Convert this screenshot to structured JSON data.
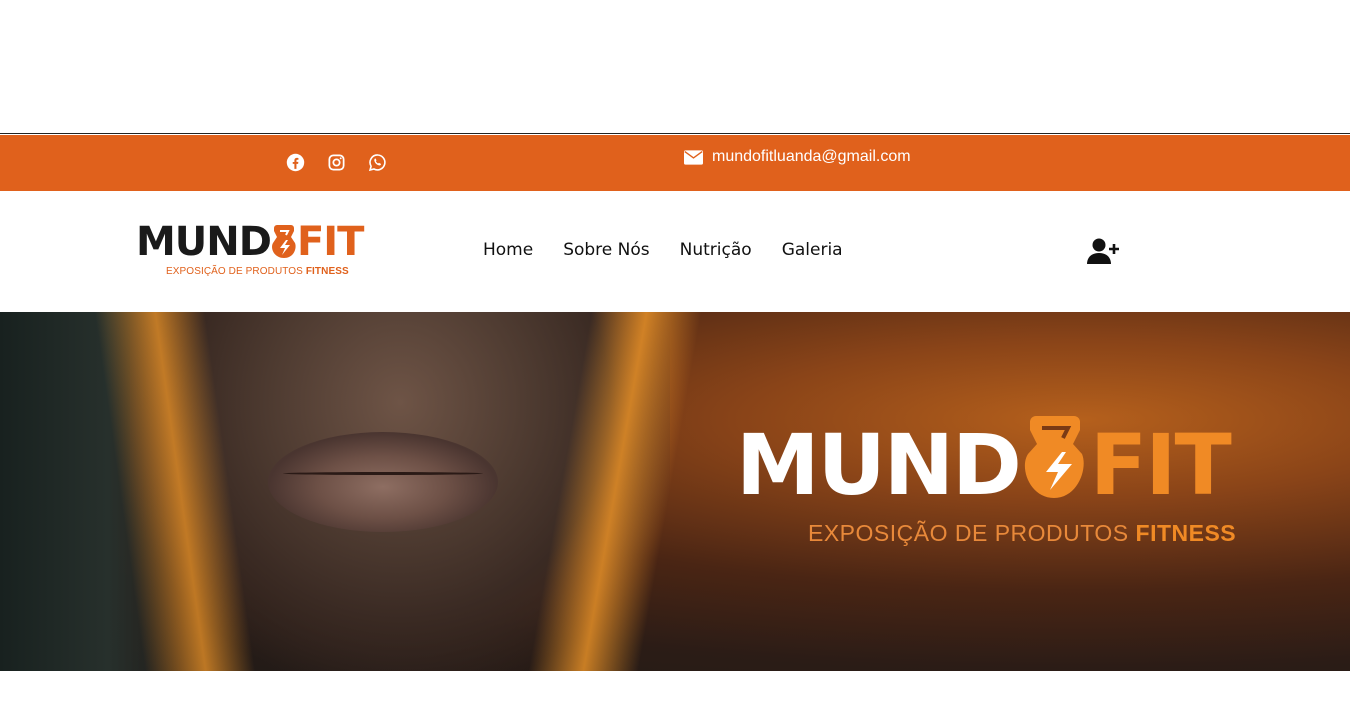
{
  "colors": {
    "brand_orange": "#e0611c",
    "accent_orange": "#f08a25",
    "text_dark": "#111111"
  },
  "topbar": {
    "social": [
      {
        "name": "facebook-icon"
      },
      {
        "name": "instagram-icon"
      },
      {
        "name": "whatsapp-icon"
      }
    ],
    "email": "mundofitluanda@gmail.com"
  },
  "logo": {
    "word_dark": "MUND",
    "word_orange": "FIT",
    "tagline_regular": "EXPOSIÇÃO DE PRODUTOS ",
    "tagline_bold": "FITNESS"
  },
  "nav": {
    "items": [
      {
        "label": "Home"
      },
      {
        "label": "Sobre Nós"
      },
      {
        "label": "Nutrição"
      },
      {
        "label": "Galeria"
      }
    ],
    "user_icon": "user-plus-icon"
  },
  "hero": {
    "brand_word_white": "MUND",
    "brand_word_orange": "FIT",
    "tagline_regular": "EXPOSIÇÃO DE PRODUTOS ",
    "tagline_bold": "FITNESS"
  }
}
